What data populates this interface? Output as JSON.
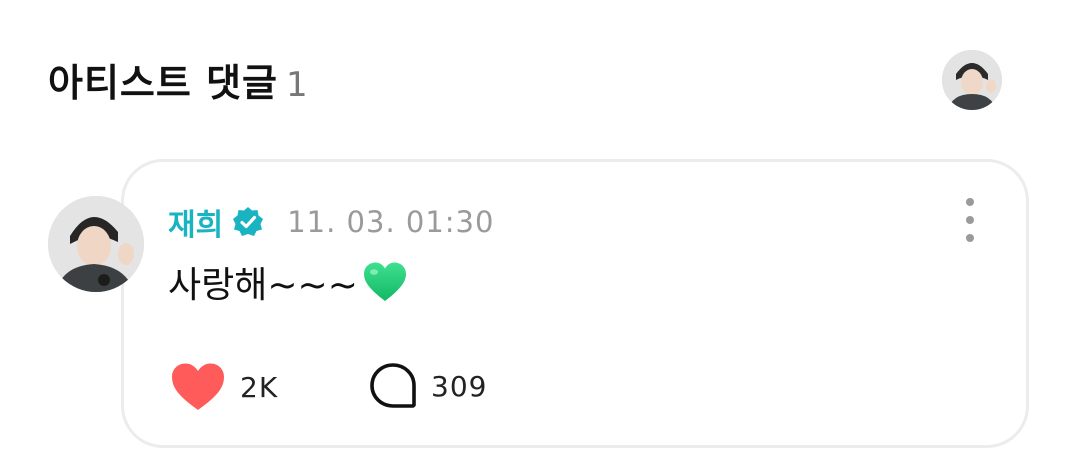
{
  "header": {
    "title": "아티스트 댓글",
    "count": "1"
  },
  "comment": {
    "author": "재희",
    "timestamp": "11. 03. 01:30",
    "text": "사랑해~~~",
    "emoji": "green-heart-emoji",
    "likes": "2K",
    "replies": "309"
  },
  "colors": {
    "author_name": "#19b3c2",
    "verified_badge": "#19b3c2",
    "like_heart": "#ff5b5b",
    "emoji_heart": "#22c97a",
    "card_border": "#ececec",
    "muted_text": "#9a9a9a"
  },
  "icons": {
    "verified": "verified-badge-icon",
    "more": "more-vertical-icon",
    "like": "heart-icon",
    "reply": "speech-bubble-icon"
  }
}
